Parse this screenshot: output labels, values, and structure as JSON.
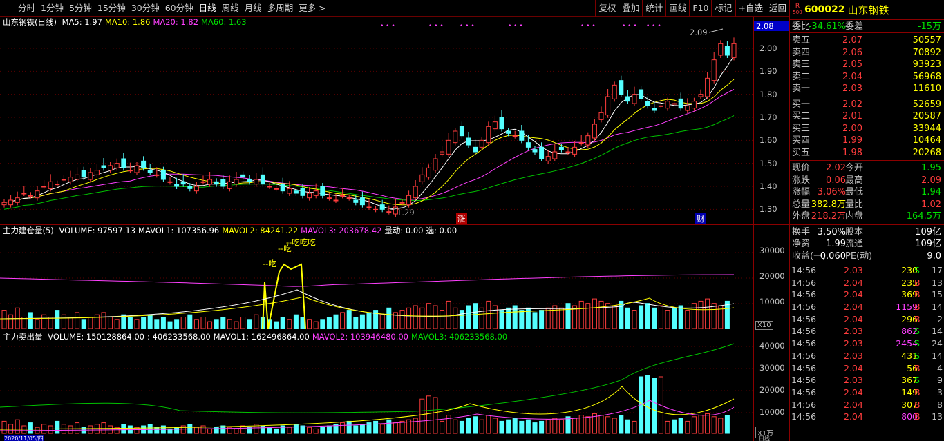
{
  "toolbar": {
    "items": [
      "分时",
      "1分钟",
      "5分钟",
      "15分钟",
      "30分钟",
      "60分钟",
      "日线",
      "周线",
      "月线",
      "多周期",
      "更多 >"
    ],
    "active": "日线",
    "right": [
      "复权",
      "叠加",
      "统计",
      "画线",
      "F10",
      "标记",
      "+自选",
      "返回"
    ]
  },
  "chart_title": {
    "name": "山东钢铁(日线)",
    "ma": [
      {
        "label": "MA5: 1.97",
        "color": "#ffffff"
      },
      {
        "label": "MA10: 1.86",
        "color": "#ffff00"
      },
      {
        "label": "MA20: 1.82",
        "color": "#ff40ff"
      },
      {
        "label": "MA60: 1.63",
        "color": "#00e000"
      }
    ]
  },
  "price_axis": {
    "labels": [
      "2.00",
      "1.90",
      "1.80",
      "1.70",
      "1.60",
      "1.50",
      "1.40",
      "1.30"
    ],
    "current": "2.08",
    "high_label": "2.09",
    "low_label": "1.29"
  },
  "markers": {
    "zhang": "涨",
    "cai": "财"
  },
  "vol_panel": {
    "title": "主力建仓量(5)",
    "items": [
      {
        "label": "VOLUME: 97597.13",
        "color": "#ffffff"
      },
      {
        "label": "MAVOL1: 107356.96",
        "color": "#ffffff"
      },
      {
        "label": "MAVOL2: 84241.22",
        "color": "#ffff00"
      },
      {
        "label": "MAVOL3: 203678.42",
        "color": "#ff40ff"
      },
      {
        "label": "量动: 0.00",
        "color": "#ffffff"
      },
      {
        "label": "选: 0.00",
        "color": "#ffffff"
      }
    ],
    "axis": [
      "30000",
      "20000",
      "10000"
    ],
    "unit": "X10",
    "eat_labels": [
      "--吃",
      "--吃",
      "--吃吃吃"
    ]
  },
  "sell_panel": {
    "title": "主力卖出量",
    "items": [
      {
        "label": "VOLUME: 150128864.00",
        "color": "#ffffff"
      },
      {
        "label": ": 406233568.00",
        "color": "#ffffff"
      },
      {
        "label": "MAVOL1: 162496864.00",
        "color": "#ffffff"
      },
      {
        "label": "MAVOL2: 103946480.00",
        "color": "#ff40ff"
      },
      {
        "label": "MAVOL3: 406233568.00",
        "color": "#00e000"
      }
    ],
    "axis": [
      "40000",
      "30000",
      "20000",
      "10000"
    ],
    "unit": "X1万"
  },
  "date_axis": {
    "left": "2020/11/05/四",
    "right": "日线"
  },
  "stock": {
    "badge_top": "R",
    "badge_bottom": "500",
    "code": "600022",
    "name": "山东钢铁"
  },
  "weibi": {
    "label": "委比",
    "value": "-34.61%",
    "label2": "委差",
    "value2": "-15万"
  },
  "asks": [
    {
      "label": "卖五",
      "price": "2.07",
      "vol": "50557"
    },
    {
      "label": "卖四",
      "price": "2.06",
      "vol": "70892"
    },
    {
      "label": "卖三",
      "price": "2.05",
      "vol": "93923"
    },
    {
      "label": "卖二",
      "price": "2.04",
      "vol": "56968"
    },
    {
      "label": "卖一",
      "price": "2.03",
      "vol": "11610"
    }
  ],
  "bids": [
    {
      "label": "买一",
      "price": "2.02",
      "vol": "52659"
    },
    {
      "label": "买二",
      "price": "2.01",
      "vol": "20587"
    },
    {
      "label": "买三",
      "price": "2.00",
      "vol": "33944"
    },
    {
      "label": "买四",
      "price": "1.99",
      "vol": "10464"
    },
    {
      "label": "买五",
      "price": "1.98",
      "vol": "20268"
    }
  ],
  "quote": [
    {
      "l1": "现价",
      "v1": "2.02",
      "c1": "red",
      "l2": "今开",
      "v2": "1.95",
      "c2": "green"
    },
    {
      "l1": "涨跌",
      "v1": "0.06",
      "c1": "red",
      "l2": "最高",
      "v2": "2.09",
      "c2": "red"
    },
    {
      "l1": "涨幅",
      "v1": "3.06%",
      "c1": "red",
      "l2": "最低",
      "v2": "1.94",
      "c2": "green"
    },
    {
      "l1": "总量",
      "v1": "382.8万",
      "c1": "yellow",
      "l2": "量比",
      "v2": "1.02",
      "c2": "red"
    },
    {
      "l1": "外盘",
      "v1": "218.2万",
      "c1": "red",
      "l2": "内盘",
      "v2": "164.5万",
      "c2": "green"
    }
  ],
  "fund": [
    {
      "l1": "换手",
      "v1": "3.50%",
      "l2": "股本",
      "v2": "109亿"
    },
    {
      "l1": "净资",
      "v1": "1.99",
      "l2": "流通",
      "v2": "109亿"
    },
    {
      "l1": "收益(一)",
      "v1": "0.060",
      "l2": "PE(动)",
      "v2": "9.0"
    }
  ],
  "ticks": [
    {
      "t": "14:56",
      "p": "2.03",
      "pc": "red",
      "v": "230",
      "vc": "yellow",
      "s": "S",
      "n": "17"
    },
    {
      "t": "14:56",
      "p": "2.04",
      "pc": "red",
      "v": "235",
      "vc": "yellow",
      "s": "B",
      "n": "13"
    },
    {
      "t": "14:56",
      "p": "2.04",
      "pc": "red",
      "v": "369",
      "vc": "yellow",
      "s": "B",
      "n": "15"
    },
    {
      "t": "14:56",
      "p": "2.04",
      "pc": "red",
      "v": "1159",
      "vc": "mag",
      "s": "B",
      "n": "14"
    },
    {
      "t": "14:56",
      "p": "2.04",
      "pc": "red",
      "v": "296",
      "vc": "yellow",
      "s": "B",
      "n": "2"
    },
    {
      "t": "14:56",
      "p": "2.03",
      "pc": "red",
      "v": "862",
      "vc": "mag",
      "s": "S",
      "n": "14"
    },
    {
      "t": "14:56",
      "p": "2.03",
      "pc": "red",
      "v": "2454",
      "vc": "mag",
      "s": "S",
      "n": "24"
    },
    {
      "t": "14:56",
      "p": "2.03",
      "pc": "red",
      "v": "431",
      "vc": "yellow",
      "s": "S",
      "n": "14"
    },
    {
      "t": "14:56",
      "p": "2.04",
      "pc": "red",
      "v": "56",
      "vc": "yellow",
      "s": "B",
      "n": "4"
    },
    {
      "t": "14:56",
      "p": "2.03",
      "pc": "red",
      "v": "367",
      "vc": "yellow",
      "s": "S",
      "n": "9"
    },
    {
      "t": "14:56",
      "p": "2.04",
      "pc": "red",
      "v": "149",
      "vc": "yellow",
      "s": "B",
      "n": "3"
    },
    {
      "t": "14:56",
      "p": "2.04",
      "pc": "red",
      "v": "307",
      "vc": "yellow",
      "s": "B",
      "n": "8"
    },
    {
      "t": "14:56",
      "p": "2.04",
      "pc": "red",
      "v": "800",
      "vc": "mag",
      "s": "B",
      "n": "13"
    }
  ],
  "chart_data": {
    "type": "candlestick",
    "title": "山东钢铁(日线)",
    "ylim": [
      1.25,
      2.12
    ],
    "closes": [
      1.33,
      1.34,
      1.35,
      1.37,
      1.36,
      1.38,
      1.4,
      1.42,
      1.41,
      1.43,
      1.44,
      1.45,
      1.44,
      1.46,
      1.47,
      1.48,
      1.49,
      1.5,
      1.48,
      1.47,
      1.49,
      1.48,
      1.46,
      1.45,
      1.43,
      1.42,
      1.4,
      1.41,
      1.39,
      1.4,
      1.42,
      1.43,
      1.41,
      1.4,
      1.42,
      1.43,
      1.44,
      1.42,
      1.43,
      1.41,
      1.4,
      1.39,
      1.38,
      1.39,
      1.37,
      1.36,
      1.37,
      1.38,
      1.36,
      1.35,
      1.34,
      1.36,
      1.35,
      1.33,
      1.32,
      1.31,
      1.3,
      1.3,
      1.29,
      1.31,
      1.33,
      1.36,
      1.4,
      1.45,
      1.48,
      1.52,
      1.55,
      1.6,
      1.64,
      1.62,
      1.58,
      1.55,
      1.6,
      1.66,
      1.68,
      1.65,
      1.63,
      1.62,
      1.6,
      1.57,
      1.55,
      1.52,
      1.53,
      1.55,
      1.56,
      1.55,
      1.57,
      1.59,
      1.62,
      1.67,
      1.72,
      1.79,
      1.84,
      1.8,
      1.77,
      1.8,
      1.78,
      1.75,
      1.73,
      1.75,
      1.77,
      1.76,
      1.74,
      1.75,
      1.77,
      1.8,
      1.87,
      1.95,
      2.02,
      1.97,
      2.02
    ],
    "vol_values": [
      8,
      6,
      9,
      5,
      7,
      4,
      6,
      5,
      8,
      6,
      5,
      7,
      4,
      5,
      6,
      7,
      5,
      4,
      6,
      5,
      4,
      5,
      6,
      4,
      5,
      3,
      4,
      5,
      6,
      4,
      5,
      3,
      4,
      5,
      4,
      3,
      5,
      4,
      6,
      5,
      4,
      3,
      5,
      4,
      6,
      5,
      4,
      3,
      4,
      5,
      6,
      7,
      8,
      5,
      6,
      7,
      8,
      6,
      9,
      7,
      8,
      9,
      10,
      9,
      11,
      10,
      8,
      12,
      9,
      8,
      10,
      11,
      9,
      12,
      10,
      8,
      9,
      10,
      8,
      9,
      7,
      8,
      9,
      10,
      9,
      11,
      10,
      12,
      11,
      13,
      12,
      11,
      10,
      12,
      9,
      8,
      10,
      11,
      9,
      10,
      8,
      9,
      10,
      8,
      11,
      12,
      13,
      11,
      10,
      12
    ]
  }
}
